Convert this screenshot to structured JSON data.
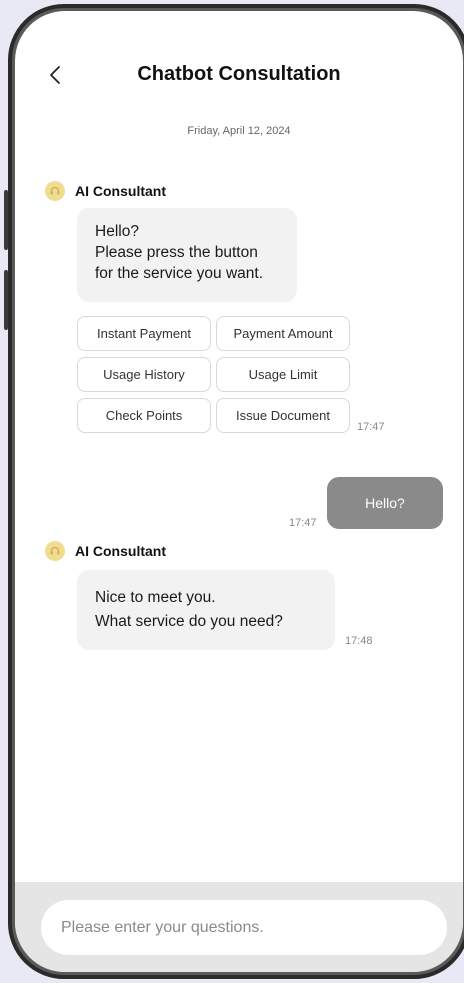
{
  "header": {
    "back_icon": "chevron-left-icon",
    "title": "Chatbot Consultation"
  },
  "date": "Friday, April 12, 2024",
  "messages": [
    {
      "sender": "AI Consultant",
      "avatar_icon": "headset-icon",
      "lines": [
        "Hello?",
        "Please press the button",
        "for the service you want."
      ],
      "time": "17:47"
    },
    {
      "sender": "user",
      "text": "Hello?",
      "time": "17:47"
    },
    {
      "sender": "AI Consultant",
      "avatar_icon": "headset-icon",
      "lines": [
        "Nice to meet you.",
        "What service do you need?"
      ],
      "time": "17:48"
    }
  ],
  "quick_replies": [
    "Instant Payment",
    "Payment Amount",
    "Usage History",
    "Usage Limit",
    "Check Points",
    "Issue Document"
  ],
  "input": {
    "placeholder": "Please enter your questions.",
    "value": ""
  },
  "colors": {
    "background": "#e8e9f4",
    "bubble_in": "#f2f2f2",
    "bubble_out": "#8a8a8a",
    "avatar": "#f0dc8e",
    "footer": "#e5e5e5"
  }
}
